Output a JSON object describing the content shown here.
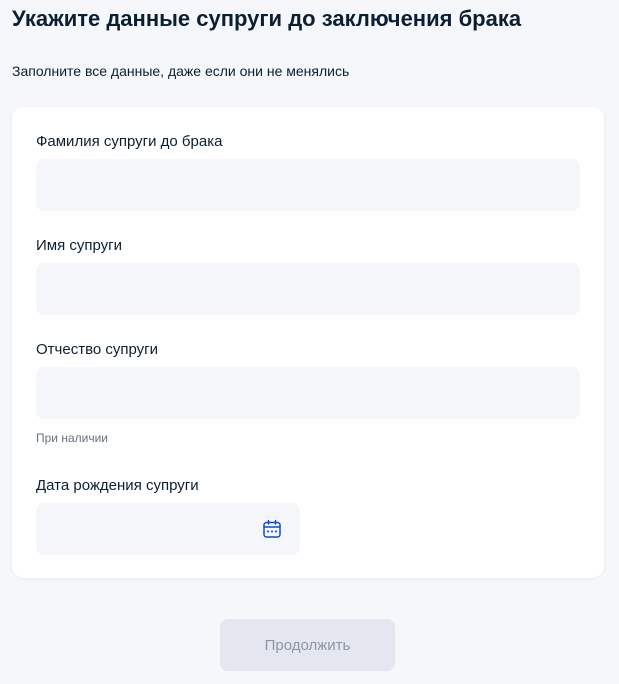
{
  "page": {
    "title": "Укажите данные супруги до заключения брака",
    "subtitle": "Заполните все данные, даже если они не менялись"
  },
  "form": {
    "fields": [
      {
        "label": "Фамилия супруги до брака",
        "value": "",
        "placeholder": ""
      },
      {
        "label": "Имя супруги",
        "value": "",
        "placeholder": ""
      },
      {
        "label": "Отчество супруги",
        "value": "",
        "placeholder": "",
        "hint": "При наличии"
      }
    ],
    "birth_date": {
      "label": "Дата рождения супруги",
      "value": "",
      "placeholder": "",
      "icon": "calendar-icon"
    }
  },
  "actions": {
    "continue_label": "Продолжить",
    "continue_enabled": false
  },
  "colors": {
    "page_background": "#f5f7fb",
    "card_background": "#ffffff",
    "input_background": "#f5f6f9",
    "text_primary": "#0b1f33",
    "text_hint": "#66727f",
    "accent": "#0d4cd3",
    "button_disabled_background": "#e4e7f0",
    "button_disabled_text": "#8d96a5"
  }
}
